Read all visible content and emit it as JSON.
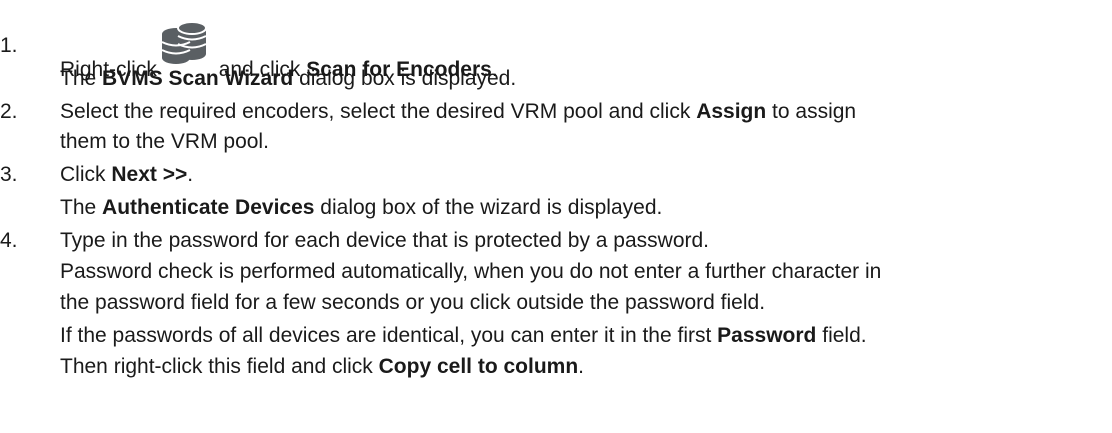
{
  "steps": [
    {
      "number": "1.",
      "line1": {
        "pre": "Right-click",
        "icon": "database-servers-icon",
        "mid": "and click",
        "bold": "Scan for Encoders",
        "post": "."
      },
      "line2": {
        "pre": "The",
        "bold": "BVMS Scan Wizard",
        "post": "dialog box is displayed."
      }
    },
    {
      "number": "2.",
      "line1": {
        "pre": "Select the required encoders, select the desired VRM pool and click",
        "bold": "Assign",
        "post": "to assign"
      },
      "line2": "them to the VRM pool."
    },
    {
      "number": "3.",
      "line1": {
        "pre": "Click",
        "bold": "Next >>",
        "post": "."
      },
      "line2": {
        "pre": "The",
        "bold": "Authenticate Devices",
        "post": "dialog box of the wizard is displayed."
      }
    },
    {
      "number": "4.",
      "line1": "Type in the password for each device that is protected by a password.",
      "line2": "Password check is performed automatically, when you do not enter a further character in",
      "line3": "the password field for a few seconds or you click outside the password field.",
      "line4": {
        "pre": "If the passwords of all devices are identical, you can enter it in the first",
        "bold": "Password",
        "post": "field."
      },
      "line5": {
        "pre": "Then right-click this field and click",
        "bold": "Copy cell to column",
        "post": "."
      }
    }
  ],
  "colors": {
    "text": "#1a1a1a",
    "icon": "#5a5f63"
  }
}
